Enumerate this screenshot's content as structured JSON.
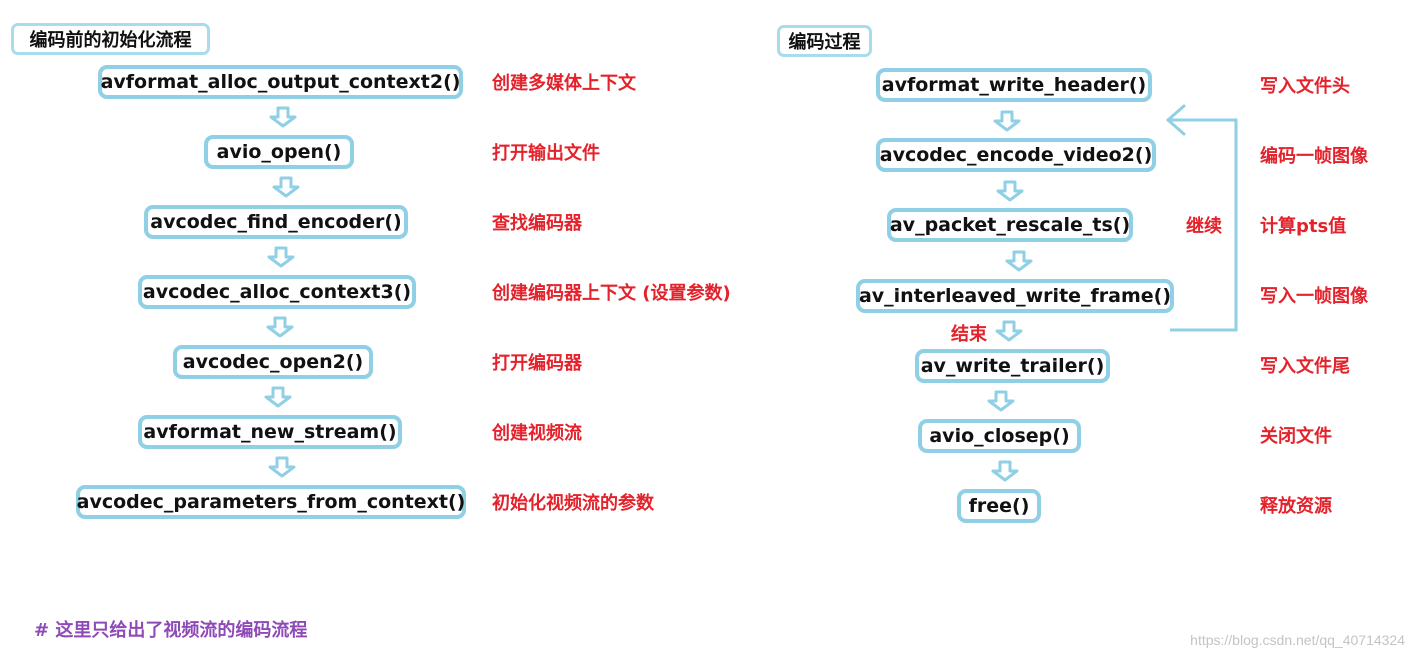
{
  "left_panel": {
    "title": "编码前的初始化流程",
    "steps": [
      {
        "fn": "avformat_alloc_output_context2()",
        "desc": "创建多媒体上下文"
      },
      {
        "fn": "avio_open()",
        "desc": "打开输出文件"
      },
      {
        "fn": "avcodec_find_encoder()",
        "desc": "查找编码器"
      },
      {
        "fn": "avcodec_alloc_context3()",
        "desc": "创建编码器上下文 (设置参数)"
      },
      {
        "fn": "avcodec_open2()",
        "desc": "打开编码器"
      },
      {
        "fn": "avformat_new_stream()",
        "desc": "创建视频流"
      },
      {
        "fn": "avcodec_parameters_from_context()",
        "desc": "初始化视频流的参数"
      }
    ]
  },
  "right_panel": {
    "title": "编码过程",
    "steps": [
      {
        "fn": "avformat_write_header()",
        "desc": "写入文件头"
      },
      {
        "fn": "avcodec_encode_video2()",
        "desc": "编码一帧图像"
      },
      {
        "fn": "av_packet_rescale_ts()",
        "desc": "计算pts值"
      },
      {
        "fn": "av_interleaved_write_frame()",
        "desc": "写入一帧图像"
      },
      {
        "fn": "av_write_trailer()",
        "desc": "写入文件尾"
      },
      {
        "fn": "avio_closep()",
        "desc": "关闭文件"
      },
      {
        "fn": "free()",
        "desc": "释放资源"
      }
    ],
    "loop_label": "继续",
    "end_label": "结束"
  },
  "note": "# 这里只给出了视频流的编码流程",
  "watermark": "https://blog.csdn.net/qq_40714324",
  "colors": {
    "box_border": "#8fd0e6",
    "arrow": "#8fd0e6",
    "desc_text": "#e3222b",
    "note_text": "#8e4bb7"
  }
}
